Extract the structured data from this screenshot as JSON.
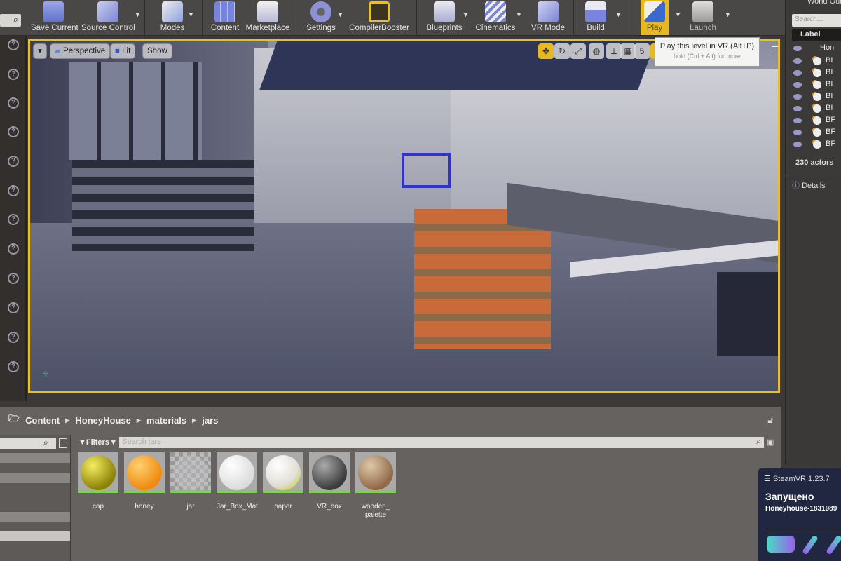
{
  "toolbar": {
    "buttons": [
      {
        "id": "save-current",
        "label": "Save Current"
      },
      {
        "id": "source-control",
        "label": "Source Control"
      },
      {
        "id": "modes",
        "label": "Modes"
      },
      {
        "id": "content",
        "label": "Content"
      },
      {
        "id": "marketplace",
        "label": "Marketplace"
      },
      {
        "id": "settings",
        "label": "Settings"
      },
      {
        "id": "compilerbooster",
        "label": "CompilerBooster"
      },
      {
        "id": "blueprints",
        "label": "Blueprints"
      },
      {
        "id": "cinematics",
        "label": "Cinematics"
      },
      {
        "id": "vr-mode",
        "label": "VR Mode"
      },
      {
        "id": "build",
        "label": "Build"
      },
      {
        "id": "play",
        "label": "Play"
      },
      {
        "id": "launch",
        "label": "Launch"
      }
    ],
    "search_icon": "search-icon"
  },
  "viewport": {
    "view_mode": "Perspective",
    "lighting": "Lit",
    "show": "Show",
    "grid_snap_value": "5",
    "tooltip": {
      "title": "Play this level in VR (Alt+P)",
      "hint": "hold (Ctrl + Alt) for more"
    }
  },
  "outliner": {
    "title": "World Outliner",
    "search_placeholder": "Search...",
    "label_header": "Label",
    "root_item": "Hon",
    "items": [
      "BI",
      "BI",
      "BI",
      "BI",
      "BI",
      "BF",
      "BF",
      "BF"
    ],
    "actor_count": "230 actors"
  },
  "details": {
    "title": "Details"
  },
  "content_browser": {
    "path": [
      "Content",
      "HoneyHouse",
      "materials",
      "jars"
    ],
    "filters_label": "Filters",
    "search_placeholder": "Search jars",
    "assets": [
      {
        "name": "cap",
        "color": "#b2a80c"
      },
      {
        "name": "honey",
        "color": "#f49a1c"
      },
      {
        "name": "jar",
        "color": "#c8c6cc"
      },
      {
        "name": "Jar_Box_Mat",
        "color": "#f2f2f2"
      },
      {
        "name": "paper",
        "color": "#eceae4"
      },
      {
        "name": "VR_box",
        "color": "#606062"
      },
      {
        "name": "wooden_ palette",
        "color": "#b89878"
      }
    ]
  },
  "steamvr": {
    "title": "SteamVR 1.23.7",
    "status": "Запущено",
    "project": "Honeyhouse-1831989"
  }
}
